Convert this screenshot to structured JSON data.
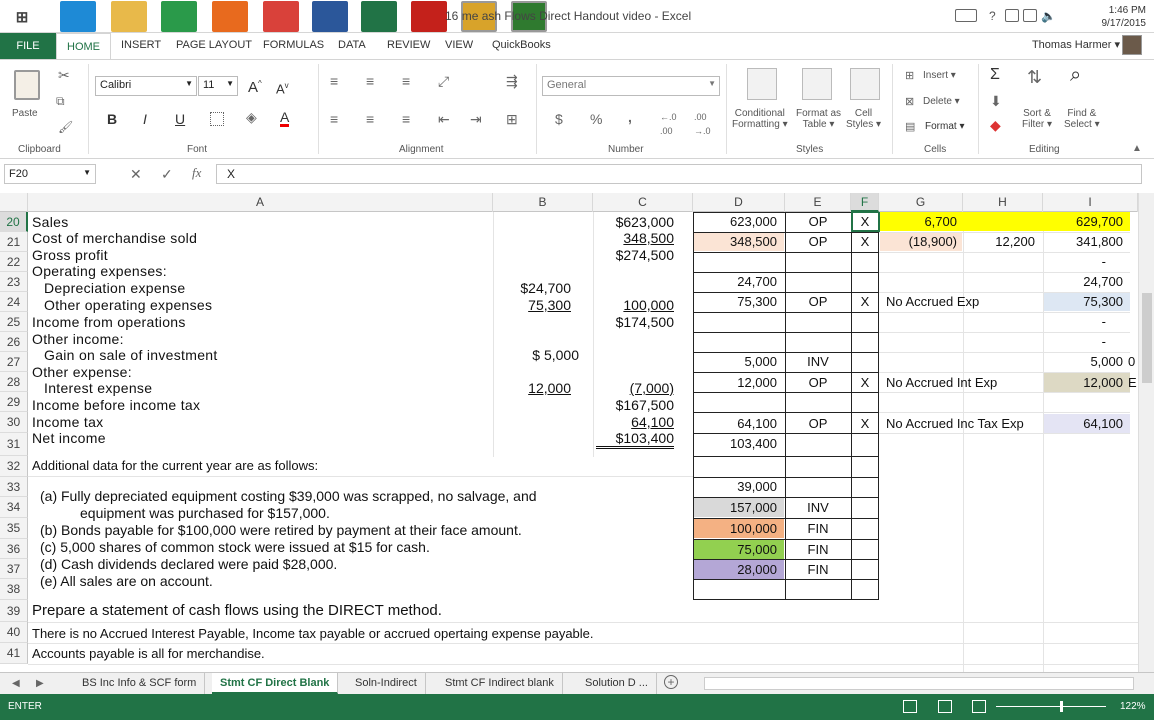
{
  "taskbar": {
    "apps": [
      {
        "name": "windows-start-icon",
        "color": "#555"
      },
      {
        "name": "internet-explorer-icon",
        "color": "#1e8ad6"
      },
      {
        "name": "file-explorer-icon",
        "color": "#e8b94a"
      },
      {
        "name": "excel-green-icon",
        "color": "#2a9a4a"
      },
      {
        "name": "firefox-icon",
        "color": "#e86a1e"
      },
      {
        "name": "microphone-icon",
        "color": "#d9413a"
      },
      {
        "name": "word-icon",
        "color": "#2b579a"
      },
      {
        "name": "excel-icon",
        "color": "#217346"
      },
      {
        "name": "acrobat-icon",
        "color": "#c4211b"
      },
      {
        "name": "app-colorful-icon",
        "color": "#d8a32a"
      },
      {
        "name": "camtasia-icon",
        "color": "#2f7a2f"
      }
    ],
    "window_title": "ash Flows  Direct Handout video - Excel",
    "title_prefix": "16",
    "title_me": "me",
    "clock_time": "1:46 PM",
    "clock_date": "9/17/2015"
  },
  "ribbon_tabs": [
    "FILE",
    "HOME",
    "INSERT",
    "PAGE LAYOUT",
    "FORMULAS",
    "DATA",
    "REVIEW",
    "VIEW",
    "QuickBooks"
  ],
  "user": {
    "name": "Thomas Harmer ▾"
  },
  "ribbon": {
    "clipboard": {
      "paste": "Paste",
      "label": "Clipboard"
    },
    "font": {
      "family": "Calibri",
      "size": "11",
      "label": "Font",
      "bold": "B",
      "italic": "I",
      "underline": "U"
    },
    "alignment": {
      "label": "Alignment"
    },
    "number": {
      "format": "General",
      "label": "Number",
      "dollar": "$",
      "percent": "%",
      "comma": ","
    },
    "styles": {
      "conditional": "Conditional",
      "formatting": "Formatting ▾",
      "format_as": "Format as",
      "table": "Table ▾",
      "cell": "Cell",
      "styles_btn": "Styles ▾",
      "label": "Styles"
    },
    "cells": {
      "insert": "Insert ▾",
      "delete": "Delete ▾",
      "format": "Format ▾",
      "label": "Cells"
    },
    "editing": {
      "sort": "Sort &",
      "filter": "Filter ▾",
      "find": "Find &",
      "select": "Select ▾",
      "label": "Editing"
    }
  },
  "formula_bar": {
    "name_box": "F20",
    "value": "X"
  },
  "columns": [
    "A",
    "B",
    "C",
    "D",
    "E",
    "F",
    "G",
    "H",
    "I"
  ],
  "rows": [
    {
      "n": "20",
      "a": "Sales",
      "b": "",
      "c": "$623,000",
      "d": "623,000",
      "e": "OP",
      "f": "X",
      "g": "6,700",
      "h": "",
      "i": "629,700"
    },
    {
      "n": "21",
      "a": "Cost of merchandise sold",
      "b": "",
      "c": "348,500",
      "d": "348,500",
      "e": "OP",
      "f": "X",
      "g": "(18,900)",
      "h": "12,200",
      "i": "341,800"
    },
    {
      "n": "22",
      "a": "Gross profit",
      "b": "",
      "c": "$274,500",
      "d": "",
      "e": "",
      "f": "",
      "g": "",
      "h": "",
      "i": "-"
    },
    {
      "n": "23",
      "a": "Operating expenses:",
      "b": "",
      "c": "",
      "d": "24,700",
      "e": "",
      "f": "",
      "g": "",
      "h": "",
      "i": "24,700"
    },
    {
      "n": "24",
      "a": "  Depreciation expense",
      "b": "$24,700",
      "c": "",
      "d": "",
      "e": "",
      "f": "",
      "g": "",
      "h": "",
      "i": ""
    },
    {
      "n": "24b",
      "a": "  Other operating expenses",
      "b": "75,300",
      "c": "100,000",
      "d": "75,300",
      "e": "OP",
      "f": "X",
      "g": "No Accrued Exp",
      "h": "",
      "i": "75,300"
    },
    {
      "n": "25",
      "a": "Income from operations",
      "b": "",
      "c": "$174,500",
      "d": "",
      "e": "",
      "f": "",
      "g": "",
      "h": "",
      "i": "-"
    },
    {
      "n": "26",
      "a": "Other income:",
      "b": "",
      "c": "",
      "d": "",
      "e": "",
      "f": "",
      "g": "",
      "h": "",
      "i": "-"
    },
    {
      "n": "27",
      "a": "  Gain on sale of investment",
      "b": "$  5,000",
      "c": "",
      "d": "5,000",
      "e": "INV",
      "f": "",
      "g": "",
      "h": "",
      "i": "5,000"
    },
    {
      "n": "27b",
      "a": "Other expense:",
      "b": "",
      "c": "",
      "d": "",
      "e": "",
      "f": "",
      "g": "",
      "h": "",
      "i": ""
    },
    {
      "n": "28",
      "a": "  Interest expense",
      "b": "12,000",
      "c": "(7,000)",
      "d": "12,000",
      "e": "OP",
      "f": "X",
      "g": "No Accrued Int Exp",
      "h": "",
      "i": "12,000"
    },
    {
      "n": "29",
      "a": "Income before income tax",
      "b": "",
      "c": "$167,500",
      "d": "",
      "e": "",
      "f": "",
      "g": "",
      "h": "",
      "i": ""
    },
    {
      "n": "30",
      "a": "Income tax",
      "b": "",
      "c": "64,100",
      "d": "64,100",
      "e": "OP",
      "f": "X",
      "g": "No Accrued Inc Tax Exp",
      "h": "",
      "i": "64,100"
    },
    {
      "n": "31",
      "a": "Net income",
      "b": "",
      "c": "$103,400",
      "d": "103,400",
      "e": "",
      "f": "",
      "g": "",
      "h": "",
      "i": ""
    }
  ],
  "additional": {
    "r32": "Additional data for the current year are as follows:",
    "r33a": "(a)   Fully depreciated equipment costing $39,000 was scrapped, no salvage, and",
    "r33b": "equipment was purchased for $157,000.",
    "r35": "(b)   Bonds payable for $100,000 were retired by payment at their face amount.",
    "r36": "(c)   5,000 shares of common stock were issued at $15 for cash.",
    "r37a": "(d)   Cash dividends declared were paid $28,000.",
    "r37b": "(e)   All sales are on account.",
    "r39": "Prepare a statement of cash flows using the DIRECT method.",
    "r40": "There is no Accrued Interest Payable, Income tax payable or accrued opertaing expense payable.",
    "r41": "Accounts payable is all for merchandise.",
    "d33": "39,000",
    "d34": "157,000",
    "e34": "INV",
    "d35": "100,000",
    "e35": "FIN",
    "d36": "75,000",
    "e36": "FIN",
    "d37": "28,000",
    "e37": "FIN",
    "i27_edge": "0",
    "i28_edge": "E"
  },
  "row_numbers": [
    "20",
    "21",
    "22",
    "23",
    "24",
    "25",
    "26",
    "27",
    "28",
    "29",
    "30",
    "31",
    "32",
    "33",
    "34",
    "35",
    "36",
    "37",
    "38",
    "39",
    "40",
    "41"
  ],
  "sheet_tabs": [
    "BS Inc Info & SCF form",
    "Stmt CF Direct Blank",
    "Soln-Indirect",
    "Stmt CF Indirect blank",
    "Solution D ..."
  ],
  "active_sheet": "Stmt CF Direct Blank",
  "status": {
    "mode": "ENTER",
    "zoom": "122%"
  },
  "colors": {
    "excel_green": "#217346",
    "yellow": "#ffff00",
    "peach": "#fbe4d5",
    "gray": "#d9d9d9",
    "orange": "#f4b183",
    "green": "#92d050",
    "purple": "#b4a7d6",
    "light_blue": "#dde7f3",
    "tan": "#ddd9c4",
    "lavender": "#e4e4f4"
  }
}
